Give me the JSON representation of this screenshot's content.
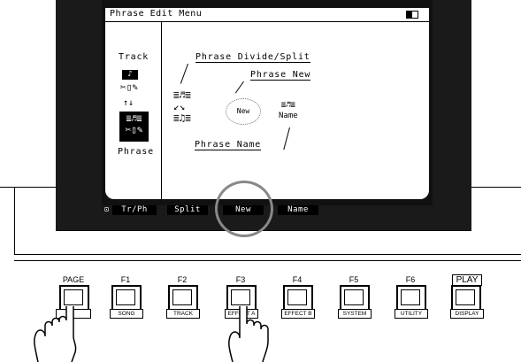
{
  "screen": {
    "title": "Phrase Edit Menu",
    "left_panel": {
      "track_label": "Track",
      "phrase_label": "Phrase"
    },
    "callouts": {
      "divide_split": "Phrase Divide/Split",
      "new": "Phrase New",
      "name": "Phrase Name"
    },
    "icon_text": {
      "new": "New",
      "name": "Name"
    },
    "function_tabs": [
      "Tr/Ph",
      "Split",
      "New",
      "Name"
    ]
  },
  "panel": {
    "page_label": "PAGE",
    "keys": [
      {
        "label": "F1",
        "sub": "SONG"
      },
      {
        "label": "F2",
        "sub": "TRACK"
      },
      {
        "label": "F3",
        "sub": "EFFECT A"
      },
      {
        "label": "F4",
        "sub": "EFFECT B"
      },
      {
        "label": "F5",
        "sub": "SYSTEM"
      },
      {
        "label": "F6",
        "sub": "UTILITY"
      }
    ],
    "play_label": "PLAY",
    "display_label": "DISPLAY"
  },
  "colors": {
    "lcd_bg": "#ffffff",
    "bezel": "#1a1a1a",
    "highlight_circle": "#888888"
  }
}
